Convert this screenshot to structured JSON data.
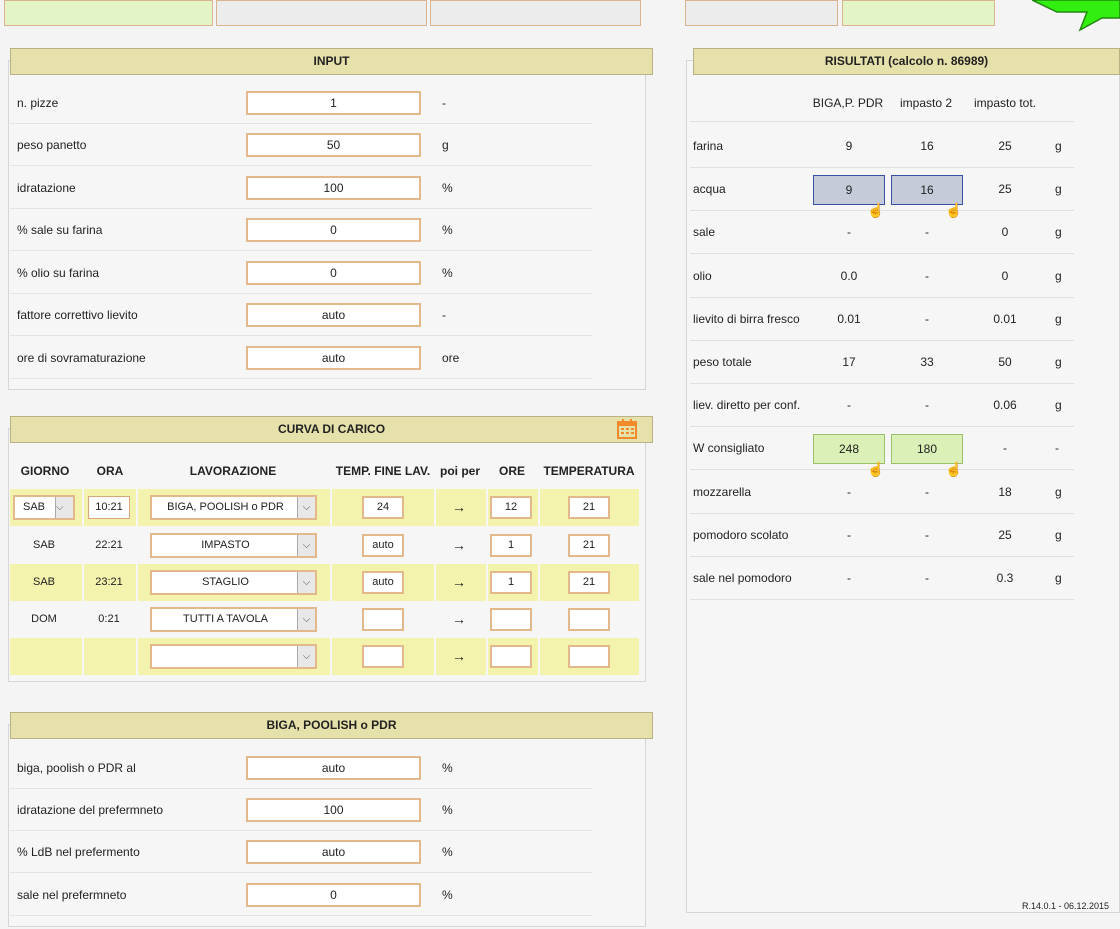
{
  "input": {
    "title": "INPUT",
    "rows": [
      {
        "label": "n. pizze",
        "value": "1",
        "unit": "-"
      },
      {
        "label": "peso panetto",
        "value": "50",
        "unit": "g"
      },
      {
        "label": "idratazione",
        "value": "100",
        "unit": "%"
      },
      {
        "label": "% sale su farina",
        "value": "0",
        "unit": "%"
      },
      {
        "label": "% olio su farina",
        "value": "0",
        "unit": "%"
      },
      {
        "label": "fattore correttivo lievito",
        "value": "auto",
        "unit": "-"
      },
      {
        "label": "ore di sovramaturazione",
        "value": "auto",
        "unit": "ore"
      }
    ]
  },
  "curva": {
    "title": "CURVA DI CARICO",
    "headers": {
      "giorno": "GIORNO",
      "ora": "ORA",
      "lavorazione": "LAVORAZIONE",
      "temp_fine": "TEMP. FINE LAV.",
      "poi_per": "poi per",
      "ore": "ORE",
      "temperatura": "TEMPERATURA"
    },
    "rows": [
      {
        "giorno": "SAB",
        "ora": "10:21",
        "lavorazione": "BIGA, POOLISH o PDR",
        "temp_fine": "24",
        "arrow": "→",
        "ore": "12",
        "temperatura": "21"
      },
      {
        "giorno": "SAB",
        "ora": "22:21",
        "lavorazione": "IMPASTO",
        "temp_fine": "auto",
        "arrow": "→",
        "ore": "1",
        "temperatura": "21"
      },
      {
        "giorno": "SAB",
        "ora": "23:21",
        "lavorazione": "STAGLIO",
        "temp_fine": "auto",
        "arrow": "→",
        "ore": "1",
        "temperatura": "21"
      },
      {
        "giorno": "DOM",
        "ora": "0:21",
        "lavorazione": "TUTTI A TAVOLA",
        "temp_fine": "",
        "arrow": "→",
        "ore": "",
        "temperatura": ""
      },
      {
        "giorno": "",
        "ora": "",
        "lavorazione": "",
        "temp_fine": "",
        "arrow": "→",
        "ore": "",
        "temperatura": ""
      }
    ]
  },
  "biga": {
    "title": "BIGA, POOLISH o PDR",
    "rows": [
      {
        "label": "biga, poolish o PDR al",
        "value": "auto",
        "unit": "%"
      },
      {
        "label": "idratazione del prefermneto",
        "value": "100",
        "unit": "%"
      },
      {
        "label": "% LdB nel prefermento",
        "value": "auto",
        "unit": "%"
      },
      {
        "label": "sale nel prefermneto",
        "value": "0",
        "unit": "%"
      }
    ]
  },
  "risultati": {
    "title": "RISULTATI (calcolo n. 86989)",
    "columns": [
      "BIGA,P. PDR",
      "impasto 2",
      "impasto tot."
    ],
    "rows": [
      {
        "label": "farina",
        "c1": "9",
        "c2": "16",
        "c3": "25",
        "unit": "g"
      },
      {
        "label": "acqua",
        "c1": "9",
        "c2": "16",
        "c3": "25",
        "unit": "g"
      },
      {
        "label": "sale",
        "c1": "-",
        "c2": "-",
        "c3": "0",
        "unit": "g"
      },
      {
        "label": "olio",
        "c1": "0.0",
        "c2": "-",
        "c3": "0",
        "unit": "g"
      },
      {
        "label": "lievito di birra fresco",
        "c1": "0.01",
        "c2": "-",
        "c3": "0.01",
        "unit": "g"
      },
      {
        "label": "peso totale",
        "c1": "17",
        "c2": "33",
        "c3": "50",
        "unit": "g"
      },
      {
        "label": "liev. diretto per conf.",
        "c1": "-",
        "c2": "-",
        "c3": "0.06",
        "unit": "g"
      },
      {
        "label": "W consigliato",
        "c1": "248",
        "c2": "180",
        "c3": "-",
        "unit": "-"
      },
      {
        "label": "mozzarella",
        "c1": "-",
        "c2": "-",
        "c3": "18",
        "unit": "g"
      },
      {
        "label": "pomodoro scolato",
        "c1": "-",
        "c2": "-",
        "c3": "25",
        "unit": "g"
      },
      {
        "label": "sale nel pomodoro",
        "c1": "-",
        "c2": "-",
        "c3": "0.3",
        "unit": "g"
      }
    ]
  },
  "version": "R.14.0.1 - 06.12.2015",
  "colors": {
    "header_bg": "#e6e1ab",
    "input_border": "#e3b98b",
    "row_highlight": "#f3f3ae",
    "blue_cell": "#c5cbd9",
    "green_cell": "#daf0b6",
    "arrow_green": "#33ee11"
  },
  "icons": {
    "calendar": "calendar-icon",
    "hand": "hand-pointer-icon",
    "next": "next-arrow-icon"
  }
}
